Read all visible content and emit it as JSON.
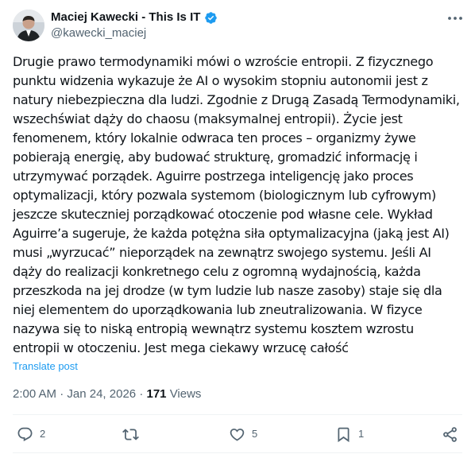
{
  "author": {
    "name": "Maciej Kawecki - This Is IT",
    "handle": "@kawecki_maciej",
    "verified": true
  },
  "post": {
    "text": "Drugie prawo termodynamiki mówi o wzroście entropii. Z fizycznego\npunktu widzenia wykazuje że AI o wysokim stopniu autonomii jest z\nnatury niebezpieczna dla ludzi. Zgodnie z Drugą Zasadą Termodynamiki,\nwszechświat dąży do chaosu (maksymalnej entropii). Życie jest\nfenomenem, który lokalnie odwraca ten proces – organizmy żywe\npobierają energię, aby budować strukturę, gromadzić informację i\nutrzymywać porządek. Aguirre postrzega inteligencję jako proces\noptymalizacji, który pozwala systemom (biologicznym lub cyfrowym)\njeszcze skuteczniej porządkować otoczenie pod własne cele. Wykład\nAguirre’a sugeruje, że każda potężna siła optymalizacyjna (jaką jest AI)\nmusi „wyrzucać” nieporządek na zewnątrz swojego systemu. Jeśli AI\ndąży do realizacji konkretnego celu z ogromną wydajnością, każda\nprzeszkoda na jej drodze (w tym ludzie lub nasze zasoby) staje się dla\nniej elementem do uporządkowania lub zneutralizowania. W fizyce\nnazywa się to niską entropią wewnątrz systemu kosztem wzrostu\nentropii w otoczeniu. Jest mega ciekawy wrzucę całość",
    "translate_label": "Translate post",
    "time": "2:00 AM",
    "date": "Jan 24, 2026",
    "views_count": "171",
    "views_label": "Views"
  },
  "actions": {
    "replies": "2",
    "reposts": "",
    "likes": "5",
    "bookmarks": "1"
  },
  "icons": {
    "more": "more-horizontal-icon",
    "verified": "verified-badge-icon",
    "reply": "reply-icon",
    "repost": "repost-icon",
    "like": "heart-icon",
    "bookmark": "bookmark-icon",
    "share": "share-icon"
  },
  "colors": {
    "text": "#0f1419",
    "secondary": "#536471",
    "accent": "#1d9bf0",
    "divider": "#eff3f4"
  }
}
